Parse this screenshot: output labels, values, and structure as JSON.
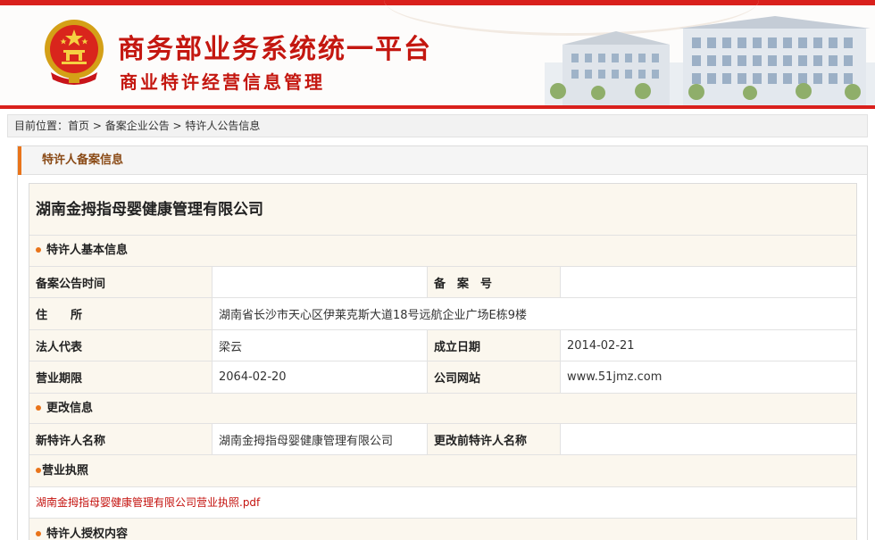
{
  "header": {
    "title_main": "商务部业务系统统一平台",
    "title_sub": "商业特许经营信息管理"
  },
  "breadcrumb": {
    "prefix": "目前位置：",
    "home": "首页",
    "sep1": " > ",
    "level2": "备案企业公告",
    "sep2": " > ",
    "level3": "特许人公告信息"
  },
  "panel": {
    "title": "特许人备案信息"
  },
  "company": {
    "name": "湖南金拇指母婴健康管理有限公司"
  },
  "basic_info": {
    "section_title": "特许人基本信息",
    "announce_time_label": "备案公告时间",
    "announce_time_value": "",
    "record_no_label": "备　案　号",
    "record_no_value": "",
    "address_label": "住　　所",
    "address_value": "湖南省长沙市天心区伊莱克斯大道18号远航企业广场E栋9楼",
    "legal_rep_label": "法人代表",
    "legal_rep_value": "梁云",
    "founded_label": "成立日期",
    "founded_value": "2014-02-21",
    "term_label": "营业期限",
    "term_value": "2064-02-20",
    "website_label": "公司网站",
    "website_value": "www.51jmz.com"
  },
  "change_info": {
    "section_title": "更改信息",
    "new_name_label": "新特许人名称",
    "new_name_value": "湖南金拇指母婴健康管理有限公司",
    "old_name_label": "更改前特许人名称",
    "old_name_value": ""
  },
  "license": {
    "section_title": "营业执照",
    "file_link": "湖南金拇指母婴健康管理有限公司营业执照.pdf"
  },
  "authorization": {
    "section_title": "特许人授权内容"
  },
  "colors": {
    "brand_red": "#c41710",
    "accent_orange": "#e9741a",
    "link_red": "#c4120e"
  }
}
